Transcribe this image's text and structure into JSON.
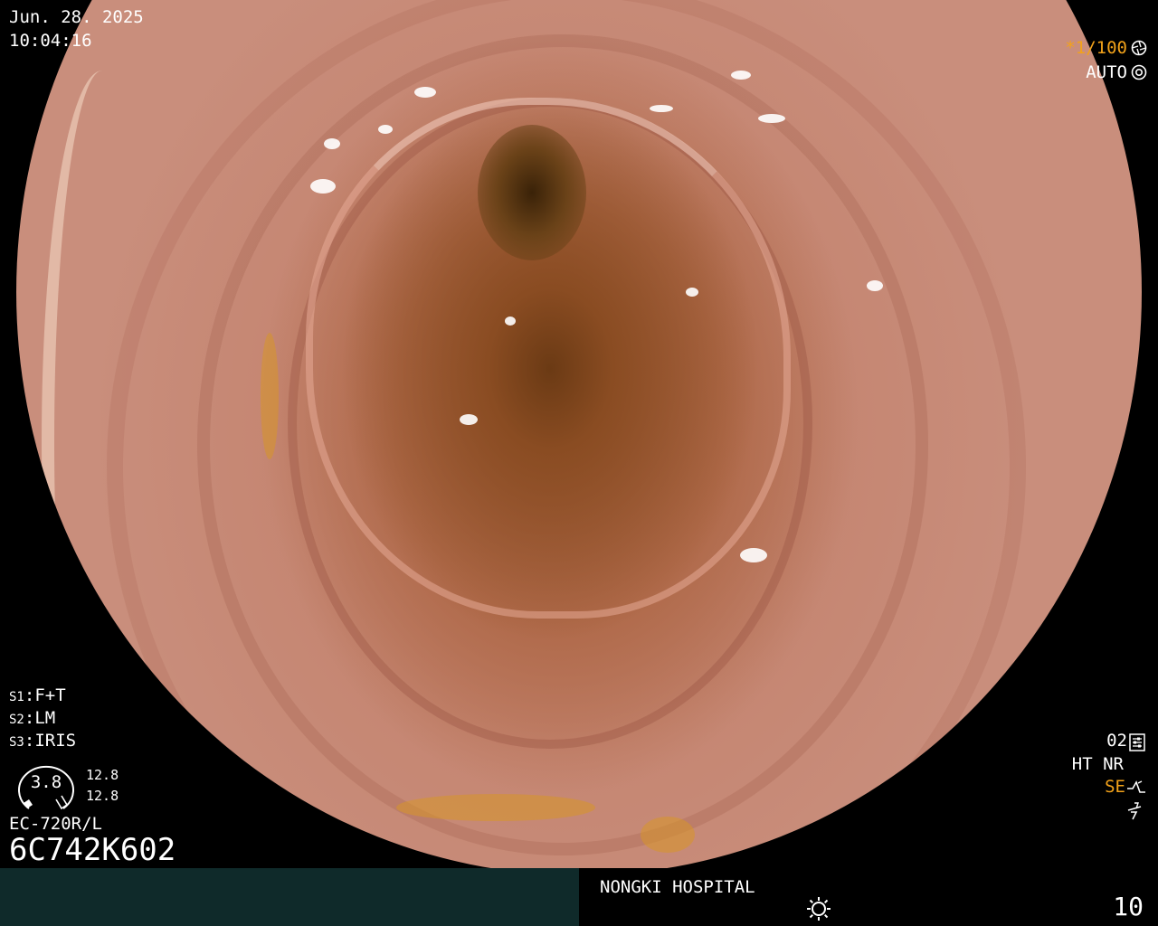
{
  "timestamp": {
    "date": "Jun. 28. 2025",
    "time": "10:04:16"
  },
  "camera": {
    "shutter": "1/100",
    "shutter_prefix": "*",
    "exposure_mode": "AUTO",
    "shutter_icon": "shutter-icon",
    "aperture_icon": "aperture-icon"
  },
  "switches": [
    {
      "key": "S1",
      "value": "F+T"
    },
    {
      "key": "S2",
      "value": "LM"
    },
    {
      "key": "S3",
      "value": "IRIS"
    }
  ],
  "zoom": {
    "value": "3.8",
    "max_a": "12.8",
    "max_b": "12.8"
  },
  "scope": {
    "model": "EC-720R/L",
    "serial": "6C742K602"
  },
  "image_settings": {
    "mode_number": "02",
    "mode_icon": "mode-settings-icon",
    "ht_nr": "HT NR",
    "se_label": "SE",
    "se_icon": "structure-enhance-icon",
    "flash_icon": "flash-off-icon"
  },
  "footer": {
    "hospital": "NONGKI HOSPITAL",
    "light_icon": "light-source-icon",
    "image_count": "10"
  },
  "colors": {
    "accent_orange": "#f2a21a",
    "bottom_left_panel": "#0f2a2a",
    "text": "#ffffff"
  }
}
